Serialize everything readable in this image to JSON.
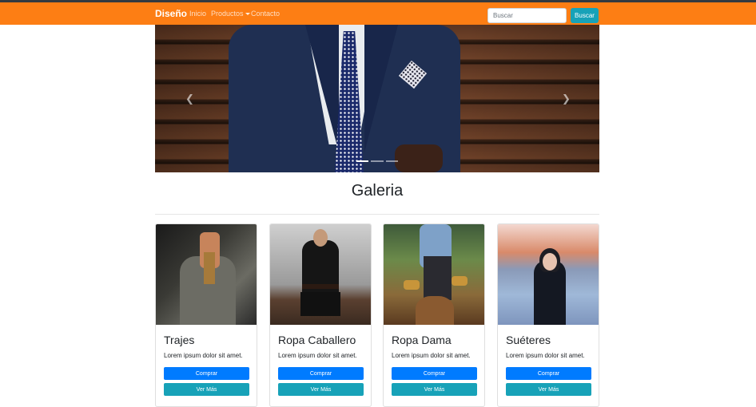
{
  "navbar": {
    "brand": "Diseño",
    "links": [
      "Inicio",
      "Productos",
      "Contacto"
    ],
    "search_placeholder": "Buscar",
    "search_button": "Buscar"
  },
  "carousel": {
    "prev_icon": "chevron-left-icon",
    "next_icon": "chevron-right-icon",
    "indicator_count": 3,
    "active_indicator": 0
  },
  "gallery": {
    "title": "Galeria",
    "cards": [
      {
        "title": "Trajes",
        "text": "Lorem ipsum dolor sit amet.",
        "buy": "Comprar",
        "more": "Ver Más"
      },
      {
        "title": "Ropa Caballero",
        "text": "Lorem ipsum dolor sit amet.",
        "buy": "Comprar",
        "more": "Ver Más"
      },
      {
        "title": "Ropa Dama",
        "text": "Lorem ipsum dolor sit amet.",
        "buy": "Comprar",
        "more": "Ver Más"
      },
      {
        "title": "Suéteres",
        "text": "Lorem ipsum dolor sit amet.",
        "buy": "Comprar",
        "more": "Ver Más"
      }
    ]
  },
  "colors": {
    "navbar": "#fd7e14",
    "primary": "#007bff",
    "info": "#17a2b8"
  }
}
